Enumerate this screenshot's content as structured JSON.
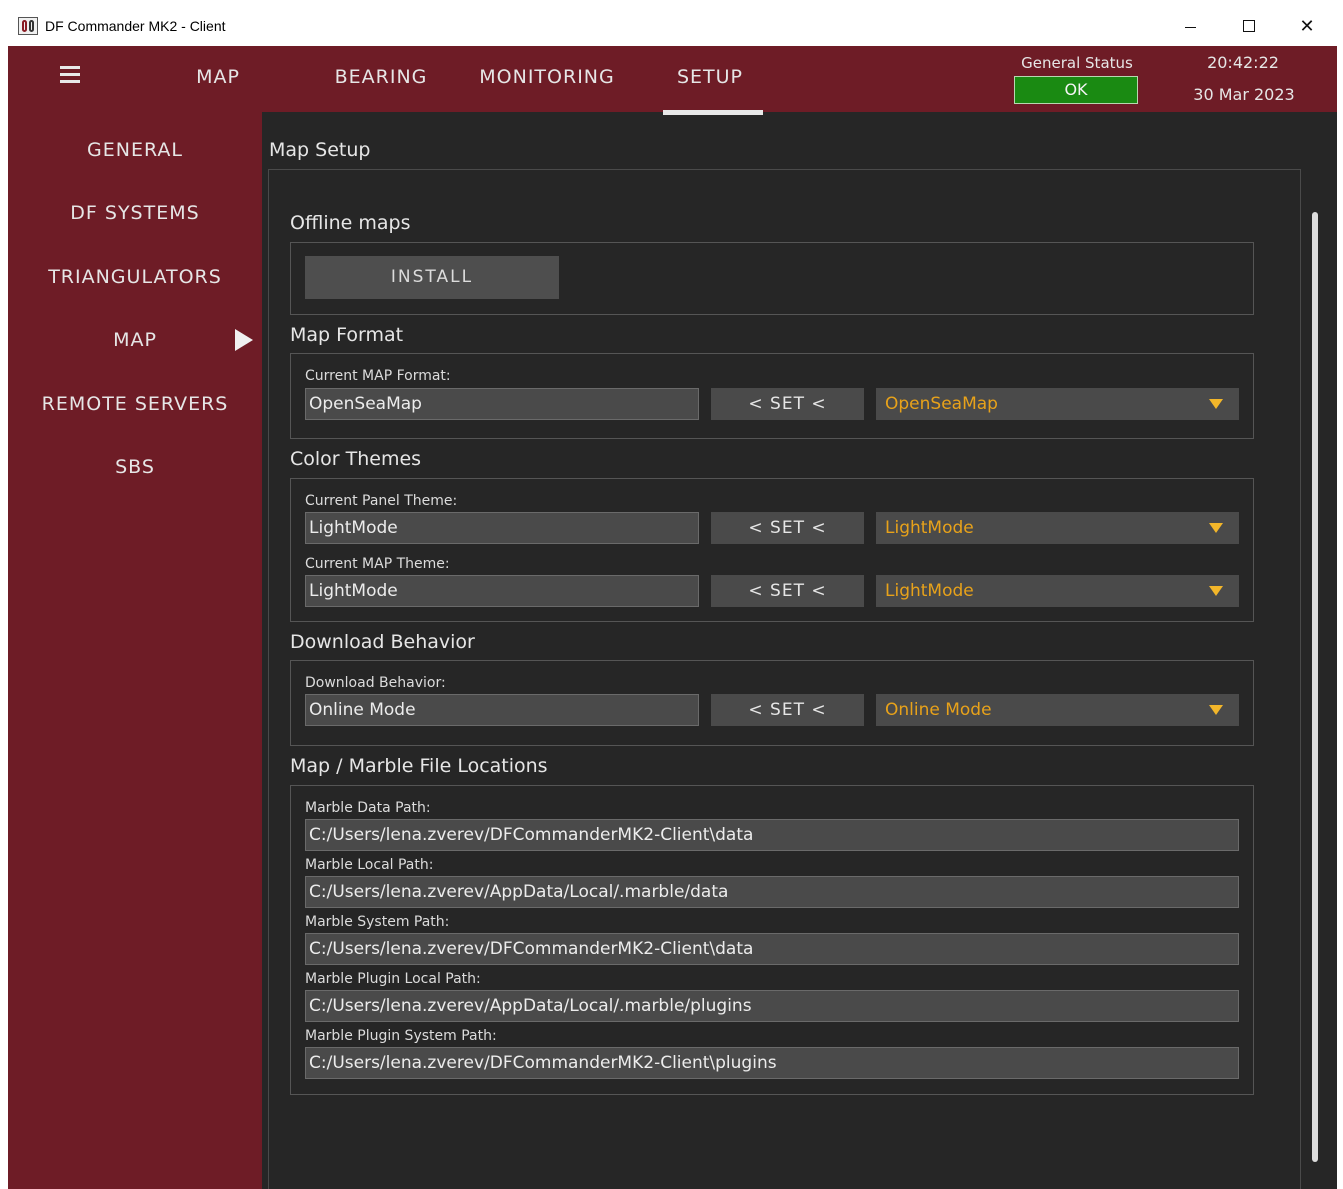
{
  "window": {
    "title": "DF Commander MK2 - Client"
  },
  "topnav": {
    "tabs": [
      "MAP",
      "BEARING",
      "MONITORING",
      "SETUP"
    ],
    "active_tab": "SETUP",
    "status_label": "General Status",
    "status_value": "OK",
    "time": "20:42:22",
    "date": "30 Mar 2023"
  },
  "sidebar": {
    "items": [
      "GENERAL",
      "DF SYSTEMS",
      "TRIANGULATORS",
      "MAP",
      "REMOTE SERVERS",
      "SBS"
    ],
    "active_item": "MAP"
  },
  "main": {
    "page_title": "Map Setup",
    "offline_maps": {
      "title": "Offline maps",
      "install_label": "INSTALL"
    },
    "map_format": {
      "title": "Map Format",
      "current_label": "Current MAP Format:",
      "current_value": "OpenSeaMap",
      "set_label": "< SET <",
      "selected_option": "OpenSeaMap"
    },
    "color_themes": {
      "title": "Color Themes",
      "panel_label": "Current Panel Theme:",
      "panel_value": "LightMode",
      "panel_set_label": "< SET <",
      "panel_selected": "LightMode",
      "map_label": "Current MAP Theme:",
      "map_value": "LightMode",
      "map_set_label": "< SET <",
      "map_selected": "LightMode"
    },
    "download_behavior": {
      "title": "Download Behavior",
      "label": "Download Behavior:",
      "value": "Online Mode",
      "set_label": "< SET <",
      "selected": "Online Mode"
    },
    "file_locations": {
      "title": "Map / Marble File Locations",
      "data_path_label": "Marble Data Path:",
      "data_path": "C:/Users/lena.zverev/DFCommanderMK2-Client\\data",
      "local_path_label": "Marble Local Path:",
      "local_path": "C:/Users/lena.zverev/AppData/Local/.marble/data",
      "system_path_label": "Marble System Path:",
      "system_path": "C:/Users/lena.zverev/DFCommanderMK2-Client\\data",
      "plugin_local_label": "Marble Plugin Local Path:",
      "plugin_local_path": "C:/Users/lena.zverev/AppData/Local/.marble/plugins",
      "plugin_system_label": "Marble Plugin System Path:",
      "plugin_system_path": "C:/Users/lena.zverev/DFCommanderMK2-Client\\plugins"
    }
  },
  "colors": {
    "brand": "#6e1c26",
    "background": "#262626",
    "accent_text": "#e8a21a",
    "status_ok": "#1a8a12"
  }
}
